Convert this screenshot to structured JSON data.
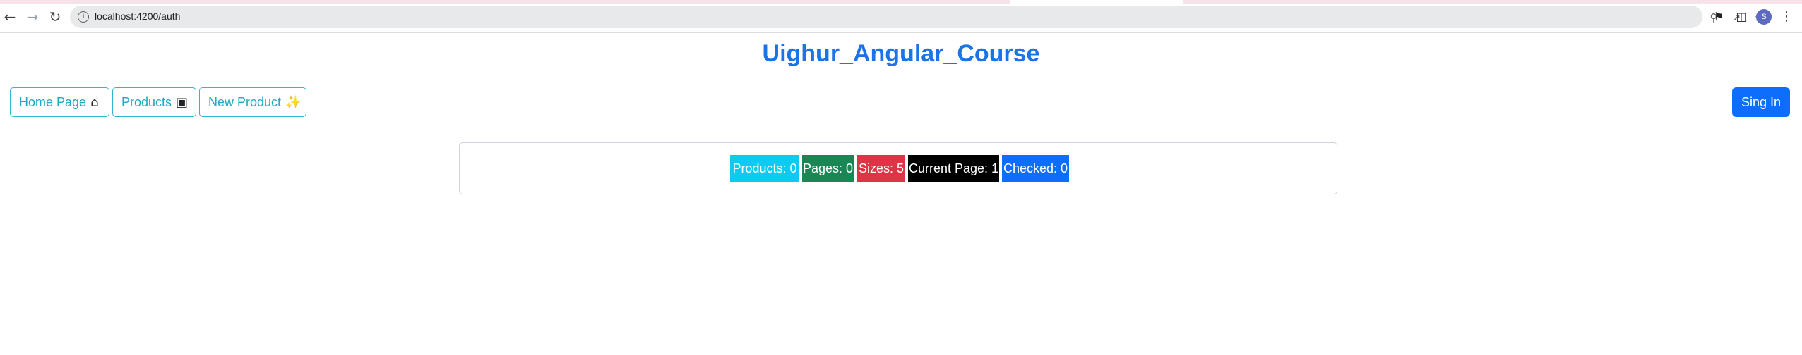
{
  "browser": {
    "url": "localhost:4200/auth",
    "profile_initial": "S",
    "icons": {
      "back": "arrow-left-icon",
      "forward": "arrow-right-icon",
      "reload": "reload-icon",
      "site_info": "info-icon",
      "zoom": "zoom-icon",
      "share": "share-icon",
      "bookmark": "star-icon",
      "extensions": "puzzle-icon",
      "side_panel": "side-panel-icon",
      "menu": "kebab-menu-icon"
    }
  },
  "header": {
    "title": "Uighur_Angular_Course"
  },
  "nav": {
    "home_label": "Home Page",
    "products_label": "Products",
    "new_product_label": "New Product",
    "sign_in_label": "Sing In"
  },
  "stats": [
    {
      "label": "Products: 0",
      "color": "#0dcaf0"
    },
    {
      "label": "Pages: 0",
      "color": "#198754"
    },
    {
      "label": "Sizes: 5",
      "color": "#dc3545"
    },
    {
      "label": "Current Page: 1",
      "color": "#000000"
    },
    {
      "label": "Checked: 0",
      "color": "#0d6efd"
    }
  ],
  "colors": {
    "title": "#1a73e8",
    "outline_button": "#2fb7cf",
    "primary_button": "#0d6efd"
  }
}
